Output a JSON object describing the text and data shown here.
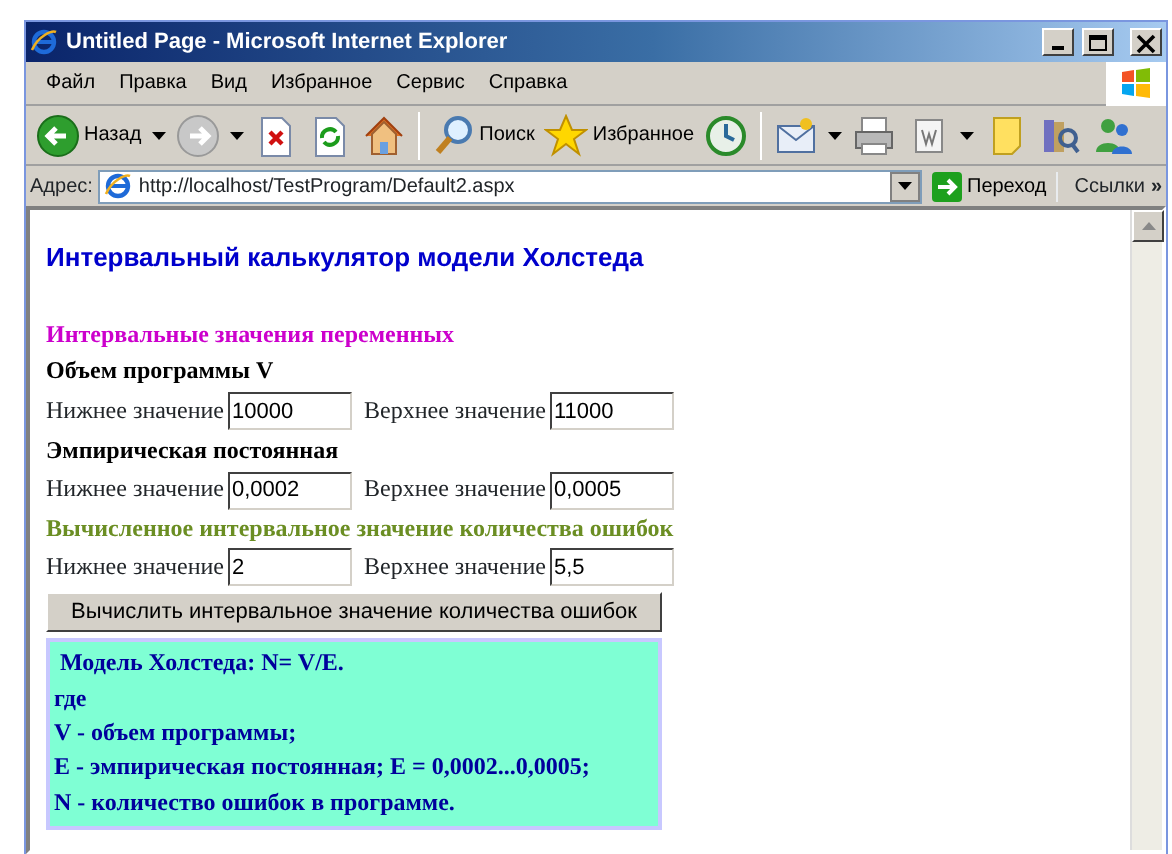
{
  "window": {
    "title": "Untitled Page - Microsoft Internet Explorer"
  },
  "menu": [
    "Файл",
    "Правка",
    "Вид",
    "Избранное",
    "Сервис",
    "Справка"
  ],
  "toolbar": [
    {
      "kind": "back",
      "label": "Назад",
      "dropdown": true
    },
    {
      "kind": "forward",
      "dropdown": true
    },
    {
      "kind": "stop",
      "dropdown": false
    },
    {
      "kind": "refresh",
      "dropdown": false
    },
    {
      "kind": "home",
      "dropdown": false
    },
    {
      "kind": "separator"
    },
    {
      "kind": "search",
      "label": "Поиск",
      "dropdown": false
    },
    {
      "kind": "favorites",
      "label": "Избранное",
      "dropdown": false
    },
    {
      "kind": "history",
      "dropdown": false
    },
    {
      "kind": "separator"
    },
    {
      "kind": "mail",
      "dropdown": true
    },
    {
      "kind": "print",
      "dropdown": false
    },
    {
      "kind": "word",
      "dropdown": true
    },
    {
      "kind": "note",
      "dropdown": false
    },
    {
      "kind": "research",
      "dropdown": false
    },
    {
      "kind": "messenger",
      "dropdown": false
    }
  ],
  "address": {
    "label": "Адрес:",
    "url": "http://localhost/TestProgram/Default2.aspx",
    "go": "Переход",
    "links": "Ссылки",
    "chevron": "»"
  },
  "page": {
    "title": "Интервальный калькулятор модели Холстеда",
    "blocks": [
      {
        "kind": "heading",
        "text": "Интервальные значения переменных",
        "color": "#cc00cc"
      },
      {
        "kind": "subheading",
        "text": "Объем программы V"
      },
      {
        "kind": "range",
        "lower_label": "Нижнее значение",
        "lower_value": "10000",
        "upper_label": "Верхнее значение",
        "upper_value": "11000"
      },
      {
        "kind": "subheading",
        "text": "Эмпирическая постоянная"
      },
      {
        "kind": "range",
        "lower_label": "Нижнее значение",
        "lower_value": "0,0002",
        "upper_label": "Верхнее значение",
        "upper_value": "0,0005"
      },
      {
        "kind": "heading",
        "text": "Вычисленное интервальное значение количества ошибок",
        "color": "#6b8e23"
      },
      {
        "kind": "range",
        "lower_label": "Нижнее значение",
        "lower_value": "2",
        "upper_label": "Верхнее значение",
        "upper_value": "5,5"
      }
    ],
    "button": "Вычислить интервальное значение количества ошибок",
    "info": [
      " Модель Холстеда: N= V/E.",
      "где",
      "V - объем программы;",
      "E - эмпирическая постоянная; E = 0,0002...0,0005;",
      "N - количество ошибок в программе."
    ]
  }
}
